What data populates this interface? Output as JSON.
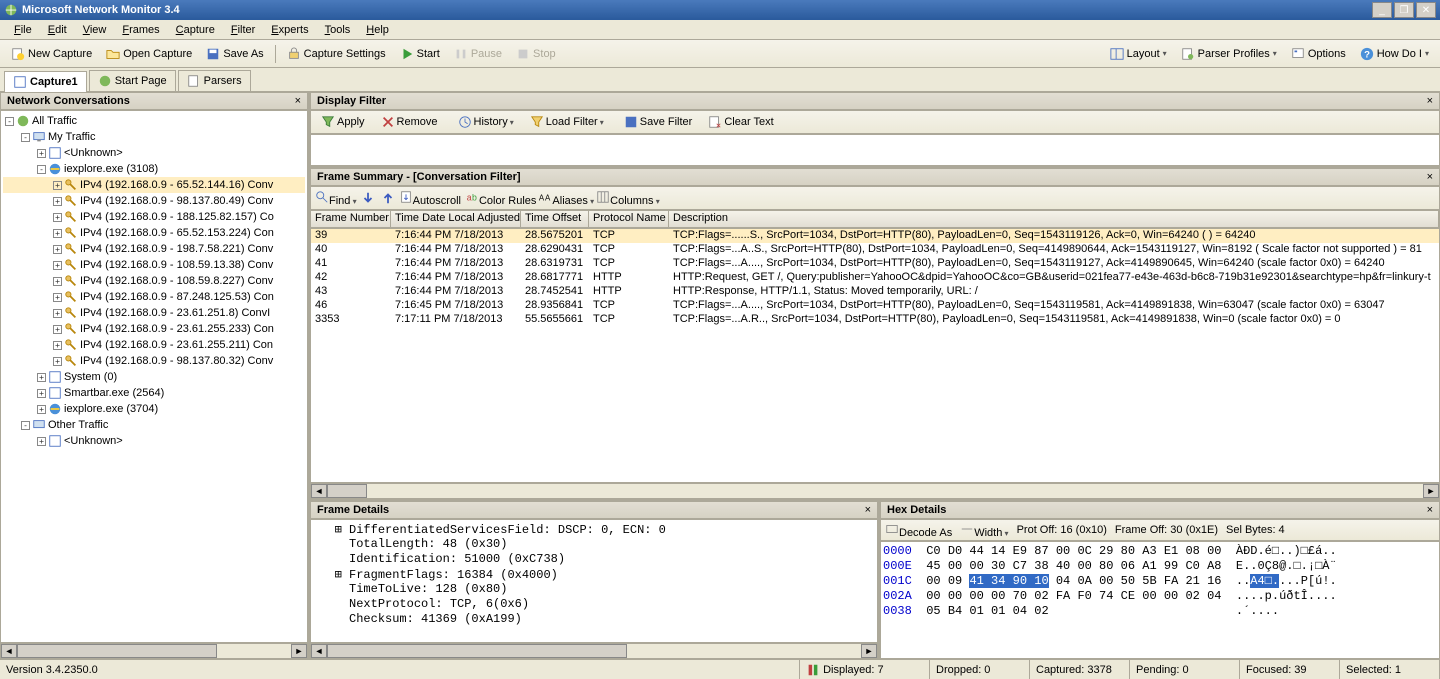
{
  "window": {
    "title": "Microsoft Network Monitor 3.4"
  },
  "menus": [
    "File",
    "Edit",
    "View",
    "Frames",
    "Capture",
    "Filter",
    "Experts",
    "Tools",
    "Help"
  ],
  "maintb": {
    "new": "New Capture",
    "open": "Open Capture",
    "saveas": "Save As",
    "capset": "Capture Settings",
    "start": "Start",
    "pause": "Pause",
    "stop": "Stop",
    "layout": "Layout",
    "parser": "Parser Profiles",
    "options": "Options",
    "help": "How Do I"
  },
  "tabs": {
    "capture": "Capture1",
    "start": "Start Page",
    "parsers": "Parsers"
  },
  "conv": {
    "title": "Network Conversations",
    "all": "All Traffic",
    "my": "My Traffic",
    "unknown": "<Unknown>",
    "ie1": "iexplore.exe (3108)",
    "ips": [
      "IPv4 (192.168.0.9 - 65.52.144.16) Conv",
      "IPv4 (192.168.0.9 - 98.137.80.49) Conv",
      "IPv4 (192.168.0.9 - 188.125.82.157) Co",
      "IPv4 (192.168.0.9 - 65.52.153.224) Con",
      "IPv4 (192.168.0.9 - 198.7.58.221) Conv",
      "IPv4 (192.168.0.9 - 108.59.13.38) Conv",
      "IPv4 (192.168.0.9 - 108.59.8.227) Conv",
      "IPv4 (192.168.0.9 - 87.248.125.53) Con",
      "IPv4 (192.168.0.9 - 23.61.251.8) ConvI",
      "IPv4 (192.168.0.9 - 23.61.255.233) Con",
      "IPv4 (192.168.0.9 - 23.61.255.211) Con",
      "IPv4 (192.168.0.9 - 98.137.80.32) Conv"
    ],
    "system": "System (0)",
    "smartbar": "Smartbar.exe (2564)",
    "ie2": "iexplore.exe (3704)",
    "other": "Other Traffic"
  },
  "filter": {
    "title": "Display Filter",
    "apply": "Apply",
    "remove": "Remove",
    "history": "History",
    "load": "Load Filter",
    "save": "Save Filter",
    "clear": "Clear Text"
  },
  "summary": {
    "title": "Frame Summary - [Conversation Filter]",
    "find": "Find",
    "auto": "Autoscroll",
    "rules": "Color Rules",
    "aliases": "Aliases",
    "columns": "Columns",
    "cols": [
      "Frame Number",
      "Time Date Local Adjusted",
      "Time Offset",
      "Protocol Name",
      "Description"
    ],
    "rows": [
      {
        "fn": "39",
        "t": "7:16:44 PM 7/18/2013",
        "o": "28.5675201",
        "p": "TCP",
        "d": "TCP:Flags=......S., SrcPort=1034, DstPort=HTTP(80), PayloadLen=0, Seq=1543119126, Ack=0, Win=64240 (  ) = 64240"
      },
      {
        "fn": "40",
        "t": "7:16:44 PM 7/18/2013",
        "o": "28.6290431",
        "p": "TCP",
        "d": "TCP:Flags=...A..S., SrcPort=HTTP(80), DstPort=1034, PayloadLen=0, Seq=4149890644, Ack=1543119127, Win=8192 ( Scale factor not supported ) = 81"
      },
      {
        "fn": "41",
        "t": "7:16:44 PM 7/18/2013",
        "o": "28.6319731",
        "p": "TCP",
        "d": "TCP:Flags=...A...., SrcPort=1034, DstPort=HTTP(80), PayloadLen=0, Seq=1543119127, Ack=4149890645, Win=64240 (scale factor 0x0) = 64240"
      },
      {
        "fn": "42",
        "t": "7:16:44 PM 7/18/2013",
        "o": "28.6817771",
        "p": "HTTP",
        "d": "HTTP:Request, GET /, Query:publisher=YahooOC&dpid=YahooOC&co=GB&userid=021fea77-e43e-463d-b6c8-719b31e92301&searchtype=hp&fr=linkury-t"
      },
      {
        "fn": "43",
        "t": "7:16:44 PM 7/18/2013",
        "o": "28.7452541",
        "p": "HTTP",
        "d": "HTTP:Response, HTTP/1.1, Status: Moved temporarily, URL: /"
      },
      {
        "fn": "46",
        "t": "7:16:45 PM 7/18/2013",
        "o": "28.9356841",
        "p": "TCP",
        "d": "TCP:Flags=...A...., SrcPort=1034, DstPort=HTTP(80), PayloadLen=0, Seq=1543119581, Ack=4149891838, Win=63047 (scale factor 0x0) = 63047"
      },
      {
        "fn": "3353",
        "t": "7:17:11 PM 7/18/2013",
        "o": "55.5655661",
        "p": "TCP",
        "d": "TCP:Flags=...A.R.., SrcPort=1034, DstPort=HTTP(80), PayloadLen=0, Seq=1543119581, Ack=4149891838, Win=0 (scale factor 0x0) = 0"
      }
    ]
  },
  "details": {
    "title": "Frame Details",
    "lines": [
      "DifferentiatedServicesField: DSCP: 0, ECN: 0",
      "TotalLength: 48 (0x30)",
      "Identification: 51000 (0xC738)",
      "FragmentFlags: 16384 (0x4000)",
      "TimeToLive: 128 (0x80)",
      "NextProtocol: TCP, 6(0x6)",
      "Checksum: 41369 (0xA199)"
    ]
  },
  "hex": {
    "title": "Hex Details",
    "decode": "Decode As",
    "width": "Width",
    "prot": "Prot Off: 16 (0x10)",
    "frame": "Frame Off: 30 (0x1E)",
    "sel": "Sel Bytes: 4",
    "rows": [
      {
        "off": "0000",
        "hex": "C0 D0 44 14 E9 87 00 0C 29 80 A3 E1 08 00",
        "asc": "ÀÐD.é□..)□£á.."
      },
      {
        "off": "000E",
        "hex": "45 00 00 30 C7 38 40 00 80 06 A1 99 C0 A8",
        "asc": "E..0Ç8@.□.¡□À¨"
      },
      {
        "off": "001C",
        "hex": "00 09 ",
        "sel": "41 34 90 10",
        "hex2": " 04 0A 00 50 5B FA 21 16",
        "asc": "..",
        "asel": "A4□.",
        "asc2": "...P[ú!."
      },
      {
        "off": "002A",
        "hex": "00 00 00 00 70 02 FA F0 74 CE 00 00 02 04",
        "asc": "....p.úðtÎ...."
      },
      {
        "off": "0038",
        "hex": "05 B4 01 01 04 02",
        "asc": ".´...."
      }
    ]
  },
  "status": {
    "version": "Version 3.4.2350.0",
    "displayed": "Displayed: 7",
    "dropped": "Dropped: 0",
    "captured": "Captured: 3378",
    "pending": "Pending: 0",
    "focused": "Focused: 39",
    "selected": "Selected: 1"
  }
}
